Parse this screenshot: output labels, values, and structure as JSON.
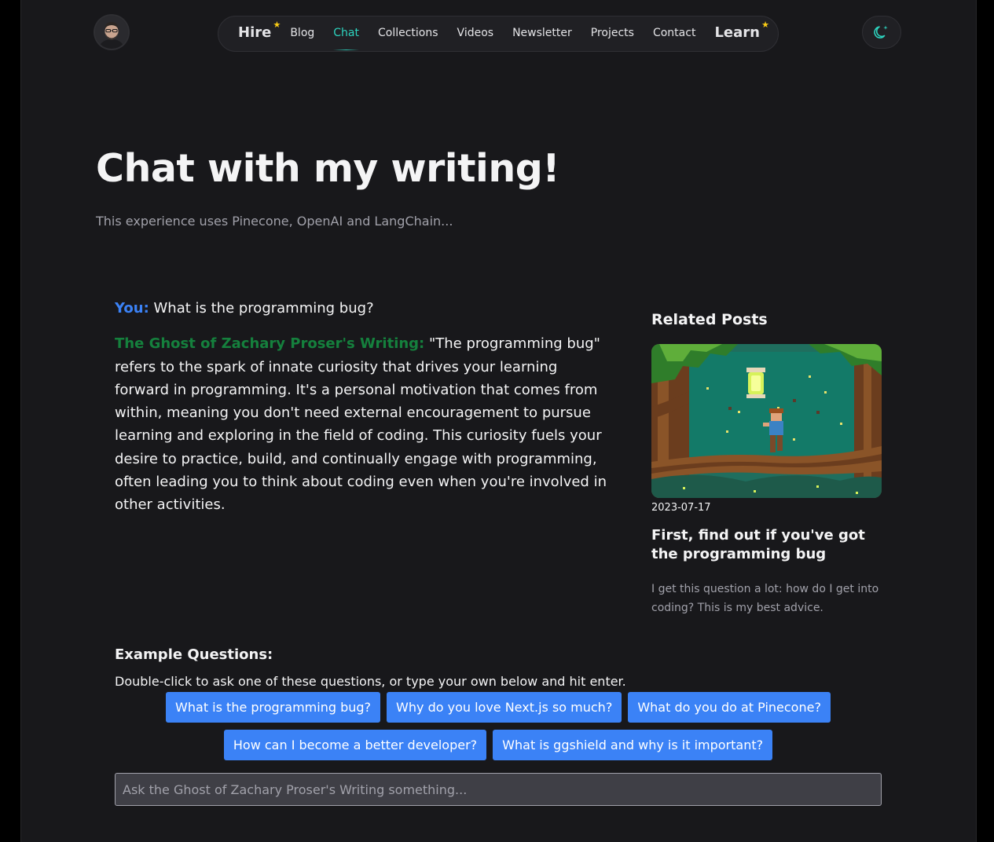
{
  "nav": {
    "items": [
      {
        "label": "Hire",
        "style": "big-star"
      },
      {
        "label": "Blog"
      },
      {
        "label": "Chat",
        "active": true
      },
      {
        "label": "Collections"
      },
      {
        "label": "Videos"
      },
      {
        "label": "Newsletter"
      },
      {
        "label": "Projects"
      },
      {
        "label": "Contact"
      },
      {
        "label": "Learn",
        "style": "big-star"
      }
    ],
    "star_glyph": "★",
    "accent_color": "#2dd4bf",
    "star_color": "#facc15"
  },
  "header": {
    "avatar_icon": "avatar-photo",
    "theme_toggle_icon": "moon-sparkle-icon"
  },
  "hero": {
    "title": "Chat with my writing!",
    "subtitle": "This experience uses Pinecone, OpenAI and LangChain..."
  },
  "chat": {
    "user_label": "You:",
    "user_message": "What is the programming bug?",
    "bot_label": "The Ghost of Zachary Proser's Writing:",
    "bot_message": "\"The programming bug\" refers to the spark of innate curiosity that drives your learning forward in programming. It's a personal motivation that comes from within, meaning you don't need external encouragement to pursue learning and exploring in the field of coding. This curiosity fuels your desire to practice, build, and continually engage with programming, often leading you to think about coding even when you're involved in other activities.",
    "user_label_color": "#3b82f6",
    "bot_label_color": "#15803d"
  },
  "related": {
    "heading": "Related Posts",
    "posts": [
      {
        "date": "2023-07-17",
        "title": "First, find out if you've got the programming bug",
        "description": "I get this question a lot: how do I get into coding? This is my best advice.",
        "image_icon": "pixel-art-forest-boy-lantern"
      }
    ]
  },
  "examples": {
    "heading": "Example Questions:",
    "help": "Double-click to ask one of these questions, or type your own below and hit enter.",
    "row1": [
      "What is the programming bug?",
      "Why do you love Next.js so much?",
      "What do you do at Pinecone?"
    ],
    "row2": [
      "How can I become a better developer?",
      "What is ggshield and why is it important?"
    ],
    "button_color": "#3b82f6"
  },
  "input": {
    "placeholder": "Ask the Ghost of Zachary Proser's Writing something...",
    "value": ""
  }
}
